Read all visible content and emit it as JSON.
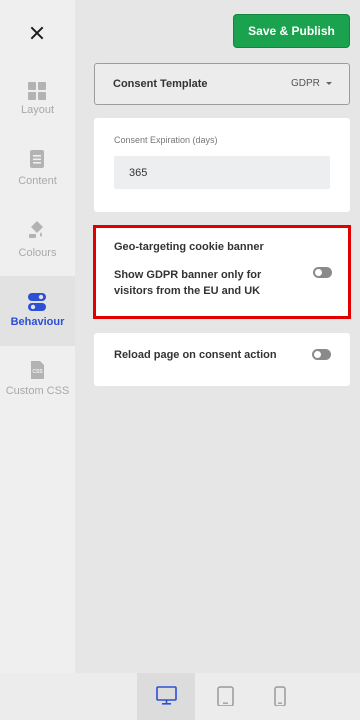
{
  "sidebar": {
    "items": [
      {
        "label": "Layout",
        "icon": "layout-grid-icon"
      },
      {
        "label": "Content",
        "icon": "document-icon"
      },
      {
        "label": "Colours",
        "icon": "paint-bucket-icon"
      },
      {
        "label": "Behaviour",
        "icon": "toggles-icon"
      },
      {
        "label": "Custom CSS",
        "icon": "css-file-icon"
      }
    ],
    "active": "Behaviour"
  },
  "header": {
    "publish_label": "Save & Publish"
  },
  "template": {
    "label": "Consent Template",
    "value": "GDPR"
  },
  "expiry": {
    "label": "Consent Expiration (days)",
    "value": "365"
  },
  "geo": {
    "title": "Geo-targeting cookie banner",
    "description": "Show GDPR banner only for visitors from the EU and UK",
    "enabled": false
  },
  "reload": {
    "title": "Reload page on consent action",
    "enabled": false
  },
  "devices": [
    "desktop-icon",
    "tablet-icon",
    "mobile-icon"
  ],
  "active_device": "desktop",
  "colors": {
    "accent": "#2c4fd6",
    "publish": "#1aa24e",
    "highlight": "#e00000"
  }
}
